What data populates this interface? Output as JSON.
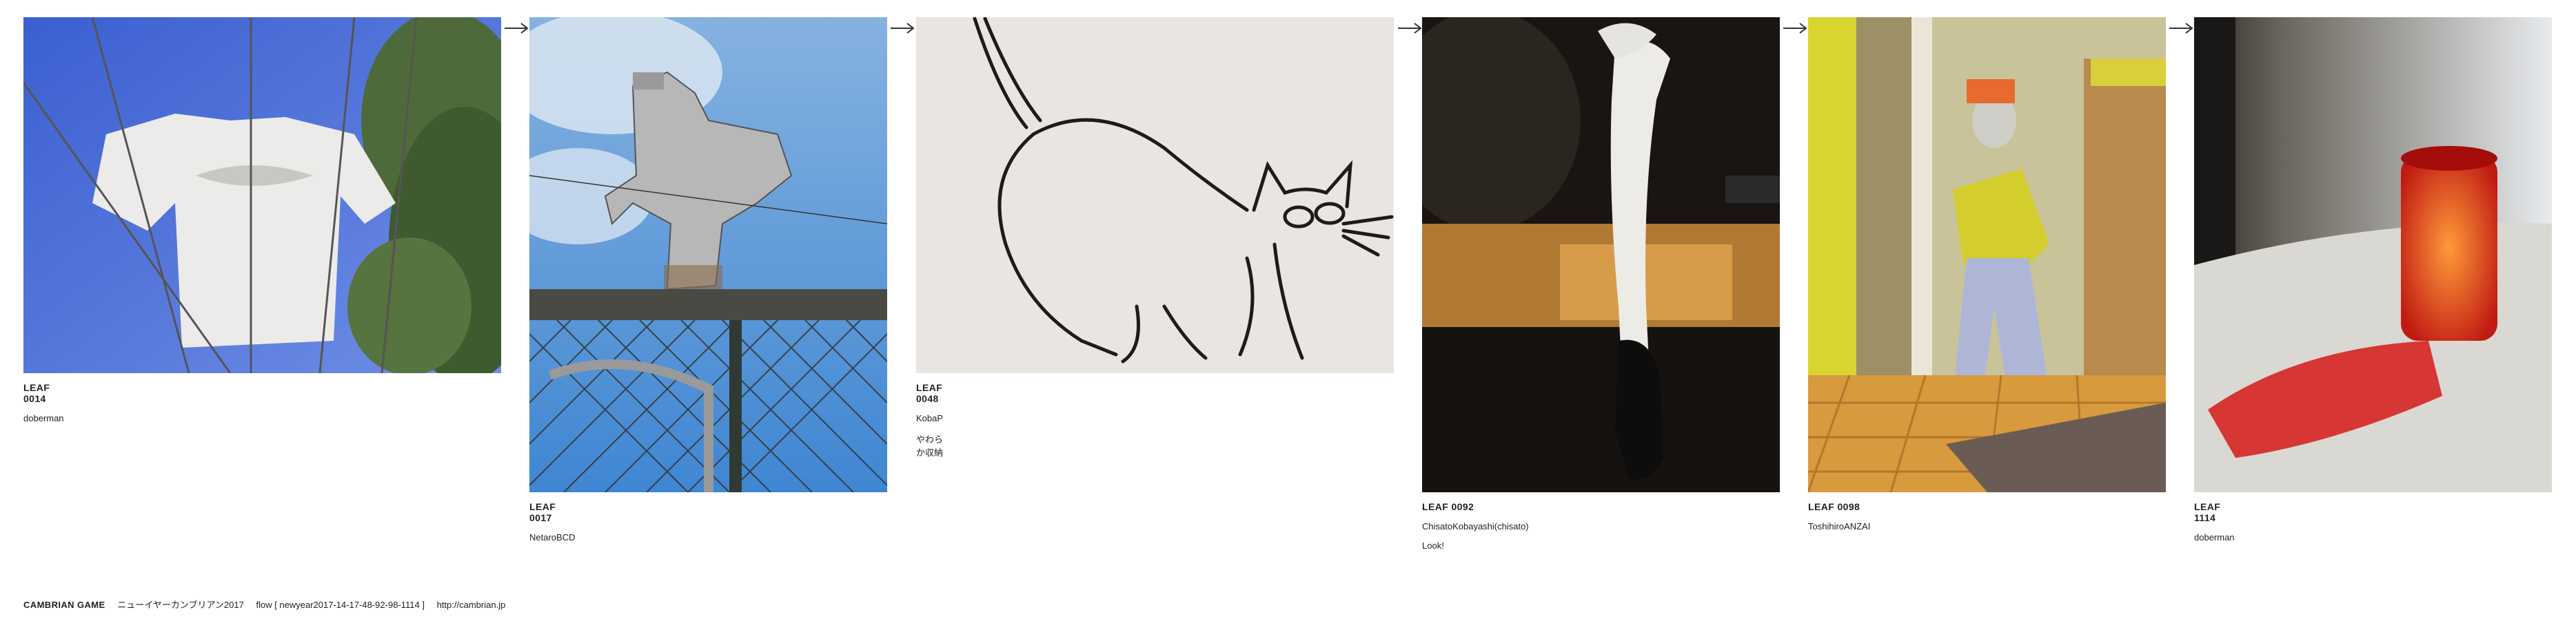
{
  "leaves": [
    {
      "id": "LEAF 0014",
      "author": "doberman",
      "note": "",
      "image": "white t-shirt hanging on wires against sky"
    },
    {
      "id": "LEAF 0017",
      "author": "NetaroBCD",
      "note": "",
      "image": "metal cutout of crouching man on a chain-link fence"
    },
    {
      "id": "LEAF 0048",
      "author": "KobaP",
      "note": "やわらか収納",
      "image": "ink line drawing of a cat on a wall"
    },
    {
      "id": "LEAF 0092",
      "author": "ChisatoKobayashi(chisato)",
      "note": "Look!",
      "image": "mannequin leg in black boot"
    },
    {
      "id": "LEAF 0098",
      "author": "ToshihiroANZAI",
      "note": "",
      "image": "mannequin in yellow shirt at shop entrance"
    },
    {
      "id": "LEAF 1114",
      "author": "doberman",
      "note": "",
      "image": "red glass cup casting red shadow"
    }
  ],
  "footer": {
    "title": "CAMBRIAN GAME",
    "subtitle": "ニューイヤーカンブリアン2017",
    "flow": "flow [ newyear2017-14-17-48-92-98-1114 ]",
    "link": "http://cambrian.jp"
  },
  "icons": [
    "right-arrow-icon"
  ]
}
